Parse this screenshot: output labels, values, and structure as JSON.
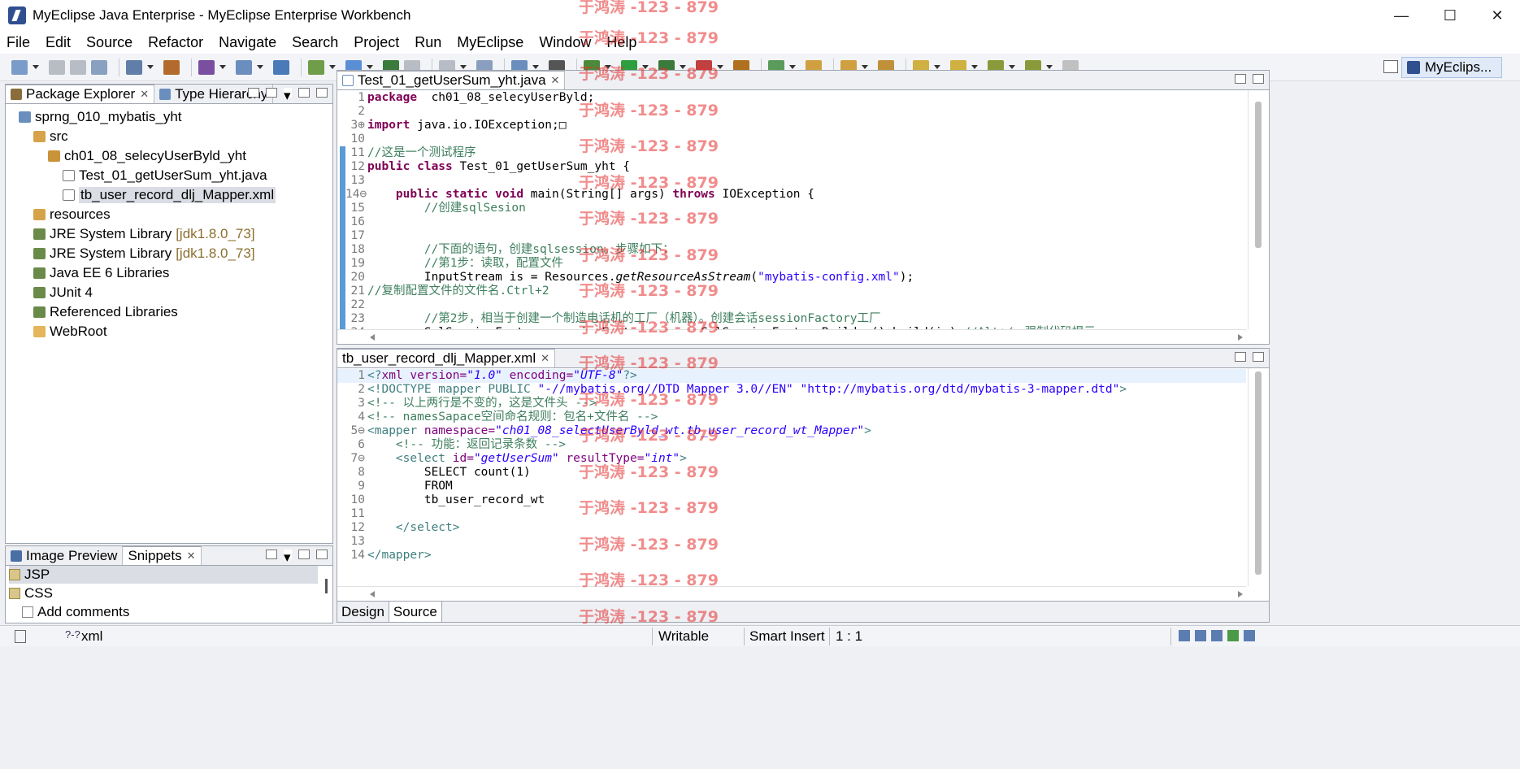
{
  "window": {
    "title": "MyEclipse Java Enterprise - MyEclipse Enterprise Workbench",
    "minimize": "—",
    "maximize": "☐",
    "close": "✕"
  },
  "menu": [
    "File",
    "Edit",
    "Source",
    "Refactor",
    "Navigate",
    "Search",
    "Project",
    "Run",
    "MyEclipse",
    "Window",
    "Help"
  ],
  "perspective": {
    "label": "MyEclips..."
  },
  "package_explorer": {
    "tabs": [
      "Package Explorer",
      "Type Hierarchy"
    ],
    "tree": [
      {
        "label": "sprng_010_mybatis_yht",
        "deco": "",
        "indent": 0,
        "icon": "project-icon"
      },
      {
        "label": "src",
        "deco": "",
        "indent": 1,
        "icon": "source-folder-icon"
      },
      {
        "label": "ch01_08_selecyUserByld_yht",
        "deco": "",
        "indent": 2,
        "icon": "package-icon"
      },
      {
        "label": "Test_01_getUserSum_yht.java",
        "deco": "",
        "indent": 3,
        "icon": "java-file-icon"
      },
      {
        "label": "tb_user_record_dlj_Mapper.xml",
        "deco": "",
        "indent": 3,
        "icon": "xml-file-icon",
        "selected": true
      },
      {
        "label": "resources",
        "deco": "",
        "indent": 1,
        "icon": "source-folder-icon"
      },
      {
        "label": "JRE System Library",
        "deco": "[jdk1.8.0_73]",
        "indent": 1,
        "icon": "library-icon"
      },
      {
        "label": "JRE System Library",
        "deco": "[jdk1.8.0_73]",
        "indent": 1,
        "icon": "library-icon"
      },
      {
        "label": "Java EE 6 Libraries",
        "deco": "",
        "indent": 1,
        "icon": "library-icon"
      },
      {
        "label": "JUnit 4",
        "deco": "",
        "indent": 1,
        "icon": "library-icon"
      },
      {
        "label": "Referenced Libraries",
        "deco": "",
        "indent": 1,
        "icon": "library-icon"
      },
      {
        "label": "WebRoot",
        "deco": "",
        "indent": 1,
        "icon": "folder-icon"
      }
    ]
  },
  "snippets": {
    "tabs": [
      "Image Preview",
      "Snippets"
    ],
    "items": [
      "JSP",
      "CSS",
      "Add comments"
    ]
  },
  "editor_java": {
    "tab": "Test_01_getUserSum_yht.java",
    "lines": [
      {
        "n": "1",
        "segs": [
          [
            "kw",
            "package"
          ],
          [
            "",
            "  ch01_08_selecyUserByld;"
          ]
        ]
      },
      {
        "n": "2",
        "segs": []
      },
      {
        "n": "3⊕",
        "segs": [
          [
            "kw",
            "import"
          ],
          [
            "",
            " java.io.IOException;□"
          ]
        ]
      },
      {
        "n": "10",
        "segs": []
      },
      {
        "n": "11",
        "segs": [
          [
            "cm",
            "//这是一个测试程序"
          ]
        ]
      },
      {
        "n": "12",
        "segs": [
          [
            "kw",
            "public class"
          ],
          [
            "",
            " Test_01_getUserSum_yht {"
          ]
        ]
      },
      {
        "n": "13",
        "segs": []
      },
      {
        "n": "14⊖",
        "segs": [
          [
            "",
            "    "
          ],
          [
            "kw",
            "public static void"
          ],
          [
            "",
            " main(String[] args) "
          ],
          [
            "kw",
            "throws"
          ],
          [
            "",
            " IOException {"
          ]
        ]
      },
      {
        "n": "15",
        "segs": [
          [
            "cm",
            "        //创建sqlSesion"
          ]
        ]
      },
      {
        "n": "16",
        "segs": []
      },
      {
        "n": "17",
        "segs": []
      },
      {
        "n": "18",
        "segs": [
          [
            "cm",
            "        //下面的语句，创建sqlsession。步骤如下："
          ]
        ]
      },
      {
        "n": "19",
        "segs": [
          [
            "cm",
            "        //第1步：读取，配置文件"
          ]
        ]
      },
      {
        "n": "20",
        "segs": [
          [
            "",
            "        InputStream is = Resources."
          ],
          [
            "it",
            "getResourceAsStream"
          ],
          [
            "",
            "("
          ],
          [
            "st",
            "\"mybatis-config.xml\""
          ],
          [
            "",
            ");"
          ]
        ]
      },
      {
        "n": "21",
        "segs": [
          [
            "cm",
            "//复制配置文件的文件名.Ctrl+2"
          ]
        ]
      },
      {
        "n": "22",
        "segs": []
      },
      {
        "n": "23",
        "segs": [
          [
            "cm",
            "        //第2步，相当于创建一个制造电话机的工厂（机器）。创建会话sessionFactory工厂"
          ]
        ]
      },
      {
        "n": "24",
        "segs": [
          [
            "",
            "        SqlSessionFactory sessionFactory = "
          ],
          [
            "kw",
            "new"
          ],
          [
            "",
            " SqlSessionFactoryBuilder().build(is);"
          ],
          [
            "cm",
            "//Alt+/，强制代码提示"
          ]
        ]
      }
    ]
  },
  "editor_xml": {
    "tab": "tb_user_record_dlj_Mapper.xml",
    "lines": [
      {
        "n": "1",
        "segs": [
          [
            "tg",
            "<?"
          ],
          [
            "at",
            "xml"
          ],
          [
            "at",
            " version="
          ],
          [
            "av",
            "\"1.0\""
          ],
          [
            "at",
            " encoding="
          ],
          [
            "av",
            "\"UTF-8\""
          ],
          [
            "tg",
            "?>"
          ]
        ]
      },
      {
        "n": "2",
        "segs": [
          [
            "tg",
            "<!DOCTYPE mapper PUBLIC "
          ],
          [
            "st",
            "\"-//mybatis.org//DTD Mapper 3.0//EN\""
          ],
          [
            "",
            " "
          ],
          [
            "st",
            "\"http://mybatis.org/dtd/mybatis-3-mapper.dtd\""
          ],
          [
            "tg",
            ">"
          ]
        ]
      },
      {
        "n": "3",
        "segs": [
          [
            "cm",
            "<!-- 以上两行是不变的，这是文件头 -->"
          ]
        ]
      },
      {
        "n": "4",
        "segs": [
          [
            "cm",
            "<!-- namesSapace空间命名规则：包名+文件名 -->"
          ]
        ]
      },
      {
        "n": "5⊖",
        "segs": [
          [
            "tg",
            "<mapper"
          ],
          [
            "at",
            " namespace="
          ],
          [
            "av",
            "\"ch01_08_selectUserByld_wt.tb_user_record_wt_Mapper\""
          ],
          [
            "tg",
            ">"
          ]
        ]
      },
      {
        "n": "6",
        "segs": [
          [
            "cm",
            "    <!-- 功能：返回记录条数 -->"
          ]
        ]
      },
      {
        "n": "7⊖",
        "segs": [
          [
            "tg",
            "    <select"
          ],
          [
            "at",
            " id="
          ],
          [
            "av",
            "\"getUserSum\""
          ],
          [
            "at",
            " resultType="
          ],
          [
            "av",
            "\"int\""
          ],
          [
            "tg",
            ">"
          ]
        ]
      },
      {
        "n": "8",
        "segs": [
          [
            "",
            "        SELECT count(1)"
          ]
        ]
      },
      {
        "n": "9",
        "segs": [
          [
            "",
            "        FROM"
          ]
        ]
      },
      {
        "n": "10",
        "segs": [
          [
            "",
            "        tb_user_record_wt"
          ]
        ]
      },
      {
        "n": "11",
        "segs": []
      },
      {
        "n": "12",
        "segs": [
          [
            "tg",
            "    </select>"
          ]
        ]
      },
      {
        "n": "13",
        "segs": []
      },
      {
        "n": "14",
        "segs": [
          [
            "tg",
            "</mapper>"
          ]
        ]
      }
    ],
    "bottom_tabs": [
      "Design",
      "Source"
    ]
  },
  "statusbar": {
    "left": "xml",
    "writable": "Writable",
    "insert_mode": "Smart Insert",
    "position": "1 : 1"
  },
  "watermark": "于鸿涛 -123 - 879"
}
